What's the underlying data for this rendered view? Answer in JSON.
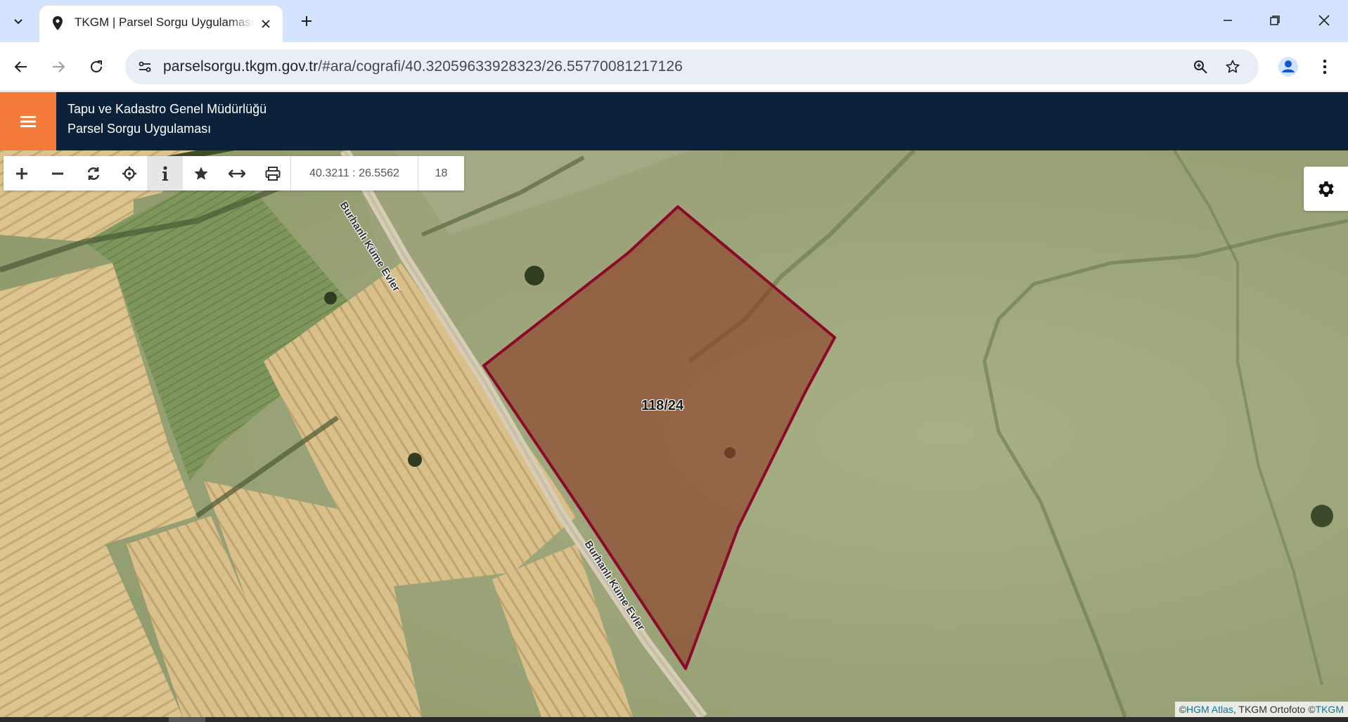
{
  "browser": {
    "tab_title": "TKGM | Parsel Sorgu Uygulaması",
    "url_host": "parselsorgu.tkgm.gov.tr",
    "url_path": "/#ara/cografi/40.32059633928323/26.55770081217126"
  },
  "app": {
    "title_line1": "Tapu ve Kadastro Genel Müdürlüğü",
    "title_line2": "Parsel Sorgu Uygulaması"
  },
  "map_toolbar": {
    "buttons": [
      "zoom-in",
      "zoom-out",
      "refresh",
      "locate",
      "info",
      "favorites",
      "measure",
      "print"
    ],
    "active": "info",
    "coordinates": "40.3211 : 26.5562",
    "zoom_level": "18"
  },
  "map": {
    "parcel_label": "118/24",
    "parcel_color": "#8b0a2a",
    "road_label_1": "Burhanlı Küme Evler",
    "road_label_2": "Burhanlı Küme Evler"
  },
  "attribution": {
    "prefix": "© ",
    "link1": "HGM Atlas",
    "middle": ", TKGM Ortofoto © ",
    "link2": "TKGM"
  },
  "colors": {
    "tabstrip": "#d3e3fd",
    "header": "#0b223a",
    "hamburger": "#f47a3a"
  }
}
